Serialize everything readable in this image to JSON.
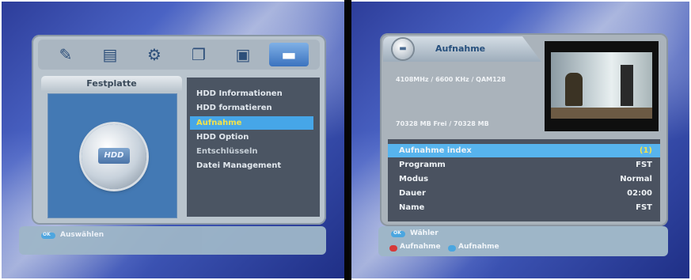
{
  "left_screen": {
    "tabs": [
      {
        "icon": "satellite-icon"
      },
      {
        "icon": "card-icon"
      },
      {
        "icon": "gear-icon"
      },
      {
        "icon": "windows-icon"
      },
      {
        "icon": "package-icon"
      },
      {
        "icon": "hdd-icon",
        "active": true
      }
    ],
    "section_title": "Festplatte",
    "hdd_label": "HDD",
    "menu_items": [
      {
        "label": "HDD Informationen"
      },
      {
        "label": "HDD formatieren"
      },
      {
        "label": "Aufnahme",
        "selected": true
      },
      {
        "label": "HDD Option"
      },
      {
        "label": "Entschlüsseln",
        "dim": true
      },
      {
        "label": "Datei Management"
      }
    ],
    "footer": {
      "key_label": "OK",
      "action_label": "Auswählen",
      "key_color": "#4aa6e0"
    }
  },
  "right_screen": {
    "title": "Aufnahme",
    "transponder_info": "4108MHz / 6600 KHz / QAM128",
    "disk_space": "70328 MB Frei / 70328 MB",
    "rows": [
      {
        "label": "Aufnahme index",
        "value": "(1)",
        "selected": true
      },
      {
        "label": "Programm",
        "value": "FST"
      },
      {
        "label": "Modus",
        "value": "Normal"
      },
      {
        "label": "Dauer",
        "value": "02:00"
      },
      {
        "label": "Name",
        "value": "FST"
      }
    ],
    "footer": {
      "key1_label": "OK",
      "action1_label": "Wähler",
      "key2_color": "#d63a3a",
      "action2_label": "Aufnahme",
      "key3_color": "#4aa6e0",
      "action3_label": "Aufnahme"
    }
  }
}
